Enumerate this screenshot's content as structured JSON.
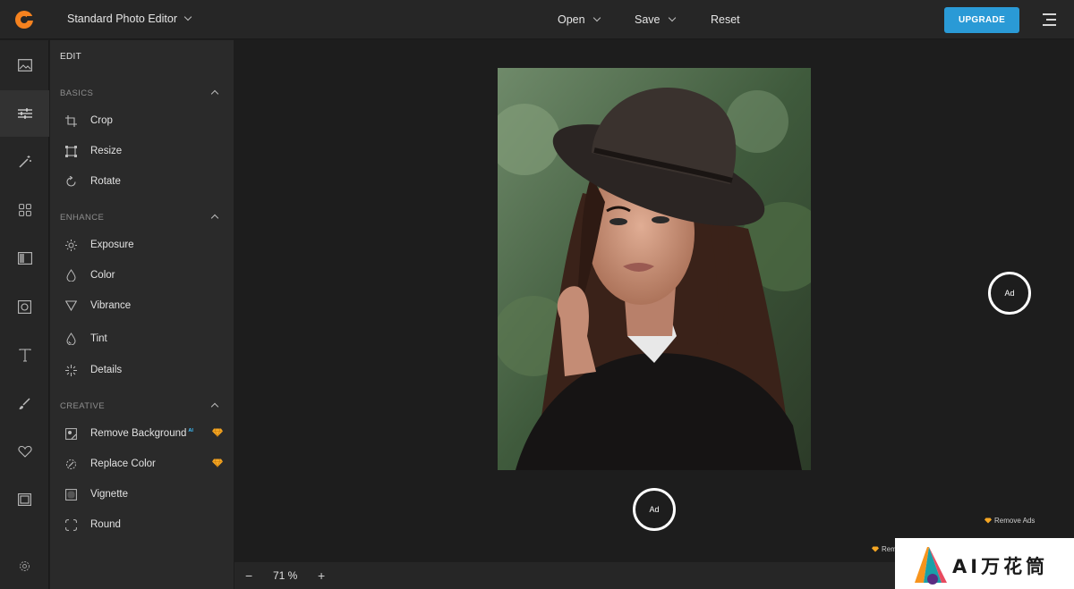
{
  "app": {
    "title": "Standard Photo Editor"
  },
  "topbar": {
    "menu": [
      {
        "label": "Open"
      },
      {
        "label": "Save"
      },
      {
        "label": "Reset"
      }
    ],
    "upgrade_label": "UPGRADE",
    "accent": "#2a9ad6",
    "logo_color": "#f5821f"
  },
  "rail": {
    "items": [
      {
        "icon": "image-icon"
      },
      {
        "icon": "sliders-icon",
        "active": true
      },
      {
        "icon": "magic-wand-icon"
      },
      {
        "icon": "grid-icon"
      },
      {
        "icon": "layout-icon"
      },
      {
        "icon": "frame-icon"
      },
      {
        "icon": "text-icon"
      },
      {
        "icon": "brush-icon"
      },
      {
        "icon": "heart-icon"
      },
      {
        "icon": "border-icon"
      },
      {
        "icon": "settings-icon"
      }
    ]
  },
  "panel": {
    "title": "EDIT",
    "sections": [
      {
        "label": "BASICS",
        "tools": [
          {
            "label": "Crop",
            "icon": "crop-icon"
          },
          {
            "label": "Resize",
            "icon": "resize-icon"
          },
          {
            "label": "Rotate",
            "icon": "rotate-icon"
          }
        ]
      },
      {
        "label": "ENHANCE",
        "tools": [
          {
            "label": "Exposure",
            "icon": "sun-icon"
          },
          {
            "label": "Color",
            "icon": "drop-icon"
          },
          {
            "label": "Vibrance",
            "icon": "triangle-icon"
          },
          {
            "label": "Tint",
            "icon": "tint-icon"
          },
          {
            "label": "Details",
            "icon": "sparkle-icon"
          }
        ]
      },
      {
        "label": "CREATIVE",
        "tools": [
          {
            "label": "Remove Background",
            "icon": "remove-bg-icon",
            "ai_tag": "AI",
            "premium": true
          },
          {
            "label": "Replace Color",
            "icon": "replace-color-icon",
            "premium": true
          },
          {
            "label": "Vignette",
            "icon": "vignette-icon"
          },
          {
            "label": "Round",
            "icon": "round-icon"
          }
        ]
      }
    ]
  },
  "canvas": {
    "ad_label": "Ad",
    "remove_ads_label": "Remove Ads",
    "remove_ads_partial": "Rem",
    "premium_color": "#f5a623"
  },
  "bottombar": {
    "zoom_out": "−",
    "zoom_value": "71 %",
    "zoom_in": "+"
  },
  "watermark": {
    "text": "AI万花筒"
  }
}
